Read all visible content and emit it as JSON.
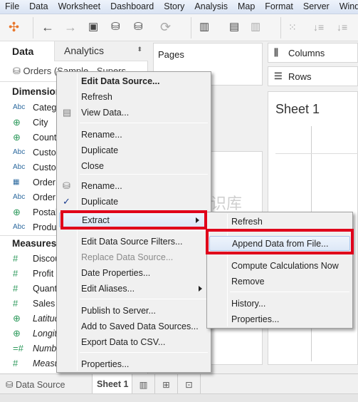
{
  "menubar": [
    "File",
    "Data",
    "Worksheet",
    "Dashboard",
    "Story",
    "Analysis",
    "Map",
    "Format",
    "Server",
    "Window"
  ],
  "toolbar": {
    "icons": [
      "tableau-logo-icon",
      "undo-icon",
      "redo-icon",
      "save-icon",
      "new-data-source-icon",
      "pause-updates-icon",
      "refresh-icon",
      "new-worksheet-icon",
      "duplicate-sheet-icon",
      "clear-sheet-icon",
      "swap-icon",
      "sort-ascending-icon",
      "sort-descending-icon"
    ]
  },
  "left": {
    "tab_data": "Data",
    "tab_analytics": "Analytics",
    "datasource": "Orders (Sample - Supers",
    "dimensions_header": "Dimensions",
    "dimensions": [
      {
        "type": "Abc",
        "label": "Category"
      },
      {
        "type": "globe",
        "label": "City"
      },
      {
        "type": "globe",
        "label": "Country"
      },
      {
        "type": "Abc",
        "label": "Customer"
      },
      {
        "type": "Abc",
        "label": "Customer"
      },
      {
        "type": "date",
        "label": "Order"
      },
      {
        "type": "Abc",
        "label": "Order"
      },
      {
        "type": "globe",
        "label": "Postal"
      },
      {
        "type": "Abc",
        "label": "Product"
      }
    ],
    "measures_header": "Measures",
    "measures": [
      {
        "type": "#",
        "label": "Discount"
      },
      {
        "type": "#",
        "label": "Profit"
      },
      {
        "type": "#",
        "label": "Quantity"
      },
      {
        "type": "#",
        "label": "Sales"
      },
      {
        "type": "globe",
        "label": "Latitude"
      },
      {
        "type": "globe",
        "label": "Longitude"
      },
      {
        "type": "=#",
        "label": "Number"
      },
      {
        "type": "#",
        "label": "Measure"
      }
    ]
  },
  "pages": {
    "label": "Pages"
  },
  "shelves": {
    "columns": "Columns",
    "rows": "Rows"
  },
  "sheet": {
    "title": "Sheet 1"
  },
  "bottom": {
    "datasource_tab": "Data Source",
    "sheet_tab": "Sheet 1"
  },
  "context_menu": {
    "items": [
      "Edit Data Source...",
      "Refresh",
      "View Data...",
      "Rename...",
      "Duplicate",
      "Close",
      "Rename...",
      "Duplicate",
      "Extract",
      "Edit Data Source Filters...",
      "Replace Data Source...",
      "Date Properties...",
      "Edit Aliases...",
      "Publish to Server...",
      "Add to Saved Data Sources...",
      "Export Data to CSV...",
      "Properties..."
    ]
  },
  "submenu": {
    "items": [
      "Refresh",
      "Append Data from File...",
      "Compute Calculations Now",
      "Remove",
      "History...",
      "Properties..."
    ]
  },
  "highlight_color": "#e0001b",
  "watermark": "小牛知识库"
}
